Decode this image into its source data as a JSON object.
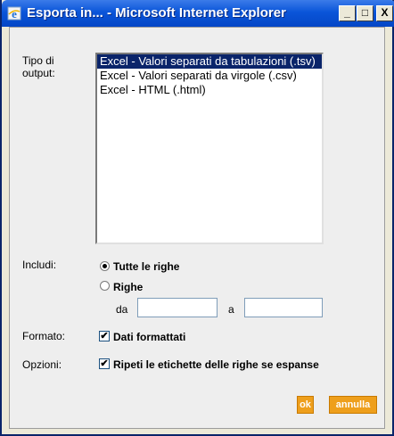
{
  "window": {
    "title": "Esporta in... - Microsoft Internet Explorer",
    "controls": {
      "minimize": "_",
      "maximize": "□",
      "close": "X"
    }
  },
  "form": {
    "output_type_label": "Tipo di output:",
    "output_options": [
      "Excel - Valori separati da tabulazioni (.tsv)",
      "Excel - Valori separati da virgole (.csv)",
      "Excel - HTML (.html)"
    ],
    "selected_output": 0,
    "include_label": "Includi:",
    "include_all": "Tutte le righe",
    "include_rows": "Righe",
    "from_label": "da",
    "to_label": "a",
    "from_value": "",
    "to_value": "",
    "format_label": "Formato:",
    "format_option": "Dati formattati",
    "format_checked": true,
    "options_label": "Opzioni:",
    "options_option": "Ripeti le etichette delle righe se espanse",
    "options_checked": true
  },
  "buttons": {
    "ok": "ok",
    "cancel": "annulla"
  }
}
